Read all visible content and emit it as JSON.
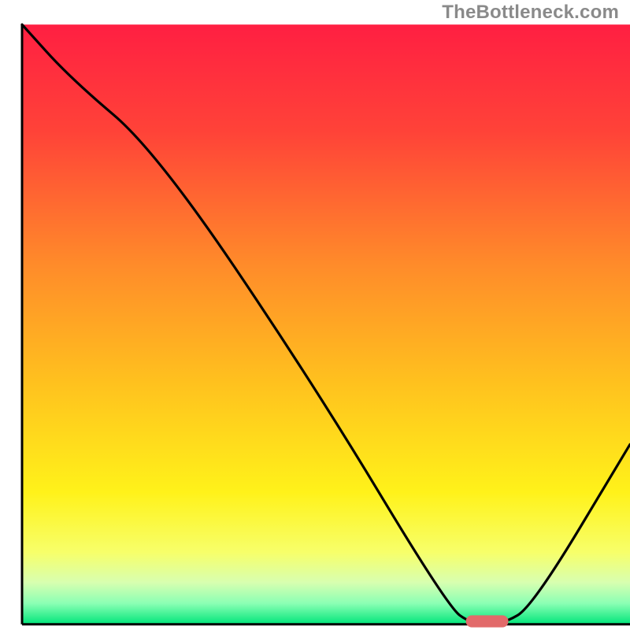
{
  "watermark": "TheBottleneck.com",
  "chart_data": {
    "type": "line",
    "title": "",
    "xlabel": "",
    "ylabel": "",
    "xlim": [
      0,
      100
    ],
    "ylim": [
      0,
      100
    ],
    "grid": false,
    "legend": false,
    "background_gradient": {
      "stops": [
        {
          "offset": 0.0,
          "color": "#ff1f42"
        },
        {
          "offset": 0.18,
          "color": "#ff4338"
        },
        {
          "offset": 0.4,
          "color": "#ff8b2a"
        },
        {
          "offset": 0.6,
          "color": "#ffc21e"
        },
        {
          "offset": 0.78,
          "color": "#fff21a"
        },
        {
          "offset": 0.88,
          "color": "#f7ff6a"
        },
        {
          "offset": 0.93,
          "color": "#d8ffb0"
        },
        {
          "offset": 0.965,
          "color": "#8bffb4"
        },
        {
          "offset": 1.0,
          "color": "#00e57a"
        }
      ]
    },
    "series": [
      {
        "name": "bottleneck-curve",
        "color": "#000000",
        "x": [
          0,
          8,
          22,
          48,
          70,
          74,
          79,
          84,
          100
        ],
        "y": [
          100,
          91,
          79,
          40,
          3,
          0,
          0,
          3,
          30
        ]
      }
    ],
    "markers": [
      {
        "name": "optimal-range",
        "shape": "rounded-bar",
        "color": "#e26a6a",
        "x_start": 73,
        "x_end": 80,
        "y": 0.5,
        "height": 2
      }
    ],
    "frame": {
      "inner_x": 3.5,
      "inner_y": 3.9,
      "inner_w": 96.5,
      "inner_h": 95.2
    }
  }
}
